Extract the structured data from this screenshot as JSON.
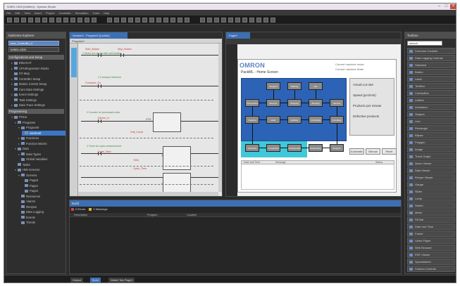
{
  "window": {
    "title": "NJ501-1300  [Untitled] - Sysmac Studio",
    "min": "–",
    "max": "□",
    "close": "×"
  },
  "menu": [
    "File",
    "Edit",
    "View",
    "Insert",
    "Project",
    "Controller",
    "Simulation",
    "Tools",
    "Help"
  ],
  "explorer": {
    "title": "Multiview Explorer",
    "device_combo": "new_Controller_0",
    "group_combo": "NJ501-1300",
    "config_section": "Configurations and Setup",
    "config_items": [
      {
        "label": "EtherCAT",
        "indent": 1,
        "twisty": "▸"
      },
      {
        "label": "CPU/Expansion Racks",
        "indent": 1,
        "twisty": "▸"
      },
      {
        "label": "I/O Map",
        "indent": 1,
        "twisty": ""
      },
      {
        "label": "Controller Setup",
        "indent": 1,
        "twisty": "▸"
      },
      {
        "label": "Motion Control Setup",
        "indent": 1,
        "twisty": "▸"
      },
      {
        "label": "Cam Data Settings",
        "indent": 1,
        "twisty": ""
      },
      {
        "label": "Event Settings",
        "indent": 1,
        "twisty": "▸"
      },
      {
        "label": "Task Settings",
        "indent": 1,
        "twisty": ""
      },
      {
        "label": "Data Trace Settings",
        "indent": 1,
        "twisty": "▸"
      }
    ],
    "prog_section": "Programming",
    "prog_items": [
      {
        "label": "POUs",
        "indent": 1,
        "twisty": "▾"
      },
      {
        "label": "Programs",
        "indent": 2,
        "twisty": "▾"
      },
      {
        "label": "Program0",
        "indent": 3,
        "twisty": "▾"
      },
      {
        "label": "Section0",
        "indent": 4,
        "twisty": "",
        "selected": true
      },
      {
        "label": "Functions",
        "indent": 3,
        "twisty": "▸"
      },
      {
        "label": "Function Blocks",
        "indent": 3,
        "twisty": "▸"
      },
      {
        "label": "Data",
        "indent": 2,
        "twisty": "▾"
      },
      {
        "label": "Data Types",
        "indent": 3,
        "twisty": "▸"
      },
      {
        "label": "Global Variables",
        "indent": 3,
        "twisty": ""
      },
      {
        "label": "Tasks",
        "indent": 2,
        "twisty": ""
      },
      {
        "label": "HMI Screens",
        "indent": 2,
        "twisty": "▾"
      },
      {
        "label": "Screens",
        "indent": 3,
        "twisty": "▾"
      },
      {
        "label": "Page0",
        "indent": 4,
        "twisty": ""
      },
      {
        "label": "Page1",
        "indent": 4,
        "twisty": ""
      },
      {
        "label": "Page2",
        "indent": 4,
        "twisty": ""
      },
      {
        "label": "Resources",
        "indent": 3,
        "twisty": ""
      },
      {
        "label": "Alarms",
        "indent": 3,
        "twisty": ""
      },
      {
        "label": "Recipes",
        "indent": 3,
        "twisty": ""
      },
      {
        "label": "Data Logging",
        "indent": 3,
        "twisty": ""
      },
      {
        "label": "Events",
        "indent": 3,
        "twisty": ""
      },
      {
        "label": "Trends",
        "indent": 3,
        "twisty": ""
      }
    ]
  },
  "ladder": {
    "tab": "Section0 - Program0 [Ladder]",
    "subhead": "Program0",
    "labels": [
      {
        "text": "Start_Button",
        "color": "red"
      },
      {
        "text": "Stop_Button",
        "color": "red"
      },
      {
        "text": "// Motor run circuit with self-holding",
        "color": "grn"
      },
      {
        "text": "// Conveyor interlock",
        "color": "grn"
      },
      {
        "text": "Conveyor_On",
        "color": "red"
      },
      {
        "text": "// Counter for processed units",
        "color": "grn"
      },
      {
        "text": "Sensor_In",
        "color": "red"
      },
      {
        "text": "CTU",
        "color": "blk"
      },
      {
        "text": "Unit_Count",
        "color": "red"
      },
      {
        "text": "// Timer for cycle measurement",
        "color": "grn"
      },
      {
        "text": "Cycle_Start",
        "color": "red"
      },
      {
        "text": "TON",
        "color": "blk"
      },
      {
        "text": "T#5s",
        "color": "red"
      },
      {
        "text": "Cycle_Time",
        "color": "red"
      },
      {
        "text": "Motor_Run",
        "color": "red"
      },
      {
        "text": "Reset",
        "color": "red"
      },
      {
        "text": "Alarm_Ack",
        "color": "red"
      }
    ]
  },
  "hmi": {
    "tab": "Page0",
    "logo": "OMRON",
    "screen_title": "PackML - Home Screen",
    "mode_label": "Current machine mode",
    "state_label": "Current machine State",
    "stats": [
      "Actual Lot rate",
      "Speed (pcs/min)",
      "Products per minute",
      "Defective products"
    ],
    "buttons": [
      "Automatic",
      "Manual",
      "Reset"
    ],
    "alarm_cols": [
      "Date and Time",
      "Message",
      "Status"
    ],
    "states": [
      "Stopped",
      "Starting",
      "Idle",
      "Suspended",
      "Execute",
      "Stopping",
      "Aborting",
      "Aborted",
      "Clearing",
      "Held",
      "Holding",
      "Unholding",
      "Complete",
      "Resetting",
      "Completing",
      "Unsuspending",
      "Suspending",
      "Stopped"
    ]
  },
  "toolbox": {
    "title": "Toolbox",
    "search": "search",
    "items": [
      "Common Controls",
      "Data Logging Controls",
      "Standard",
      "Button",
      "Label",
      "TextBox",
      "ComboBox",
      "ListBox",
      "Animation",
      "Shapes",
      "Line",
      "Rectangle",
      "Ellipse",
      "Polygon",
      "Image",
      "Trend Graph",
      "Alarm Viewer",
      "Data Viewer",
      "Recipe Viewer",
      "Gauge",
      "Slider",
      "Lamp",
      "Switch",
      "Meter",
      "Fill Bar",
      "Date and Time",
      "Frame",
      "Video Player",
      "Web Browser",
      "PDF Viewer",
      "Spreadsheet",
      "Custom Controls"
    ]
  },
  "output": {
    "title": "Build",
    "errors": "0 Errors",
    "warnings": "0 Warnings",
    "cols": [
      "Description",
      "Program",
      "Location"
    ]
  },
  "statusbar": [
    "Output",
    "Build",
    "Watch Tab Page1"
  ]
}
